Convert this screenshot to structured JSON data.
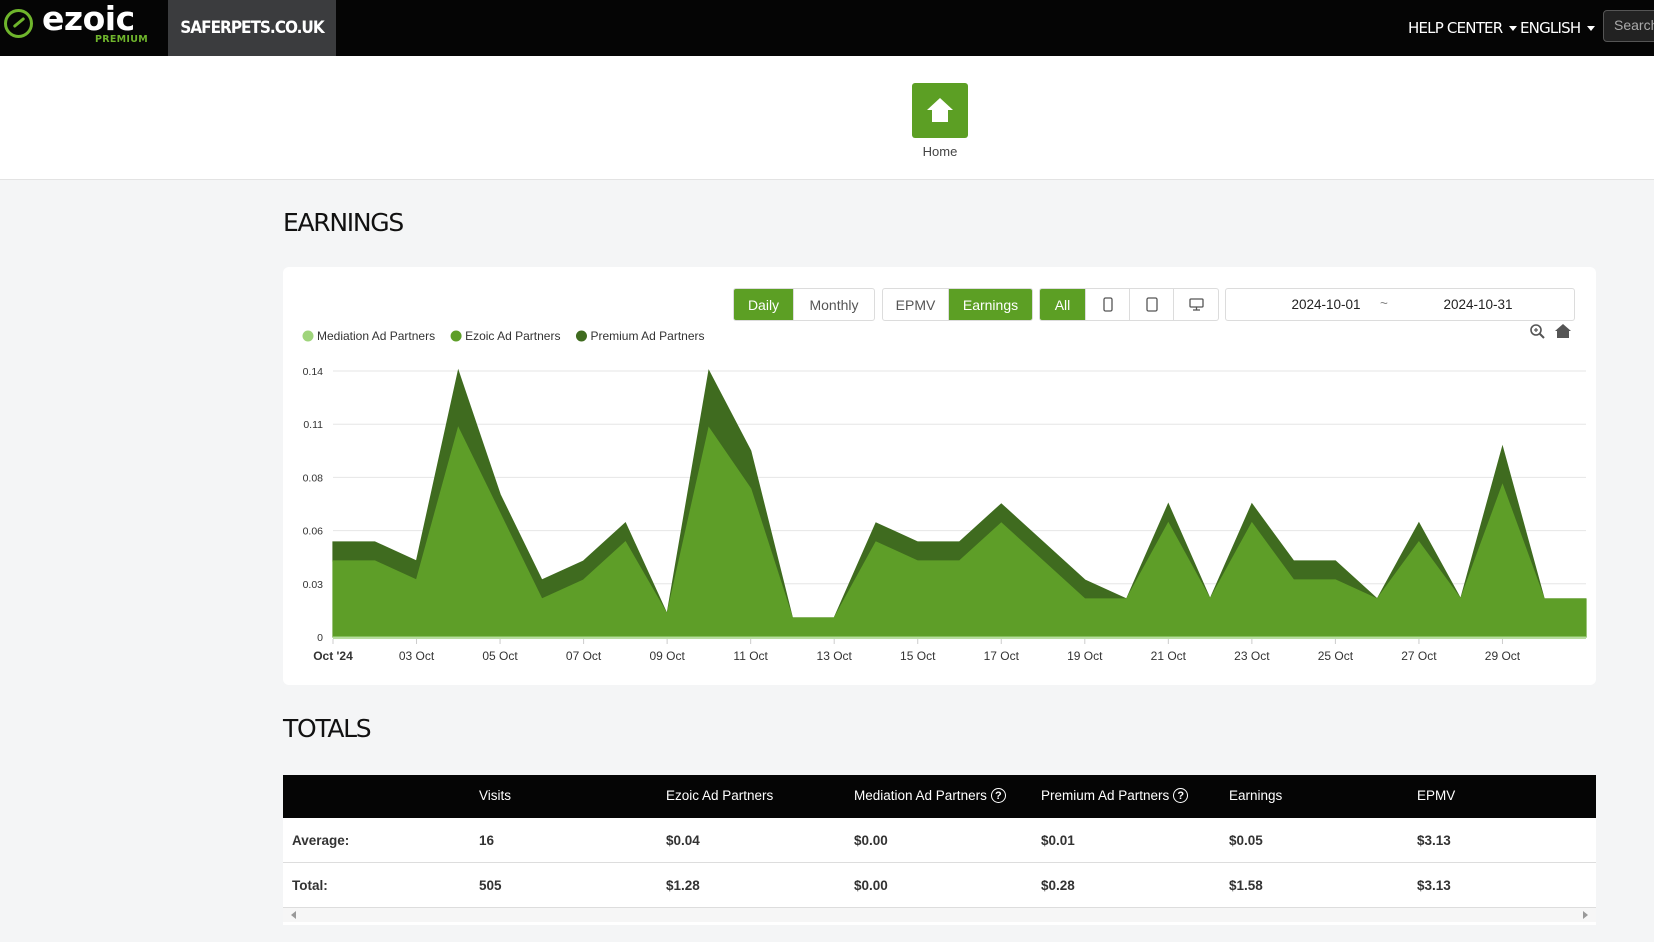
{
  "topbar": {
    "logo_text": "ezoic",
    "logo_sub": "PREMIUM",
    "site_name": "SAFERPETS.CO.UK",
    "help_center": "HELP CENTER",
    "language": "ENGLISH",
    "search_placeholder": "Search"
  },
  "home": {
    "label": "Home"
  },
  "earnings": {
    "title": "EARNINGS",
    "period_buttons": [
      "Daily",
      "Monthly"
    ],
    "metric_buttons": [
      "EPMV",
      "Earnings"
    ],
    "device_all": "All",
    "date_from": "2024-10-01",
    "date_sep": "~",
    "date_to": "2024-10-31"
  },
  "chart_data": {
    "type": "area",
    "stacked": true,
    "title": "",
    "xlabel": "",
    "ylabel": "",
    "ylim": [
      0,
      0.14
    ],
    "yticks": [
      "0",
      "0.03",
      "0.06",
      "0.08",
      "0.11",
      "0.14"
    ],
    "ytick_values": [
      0,
      0.028,
      0.056,
      0.084,
      0.112,
      0.14
    ],
    "xtick_labels": [
      "Oct '24",
      "03 Oct",
      "05 Oct",
      "07 Oct",
      "09 Oct",
      "11 Oct",
      "13 Oct",
      "15 Oct",
      "17 Oct",
      "19 Oct",
      "21 Oct",
      "23 Oct",
      "25 Oct",
      "27 Oct",
      "29 Oct"
    ],
    "x": [
      "2024-10-01",
      "2024-10-02",
      "2024-10-03",
      "2024-10-04",
      "2024-10-05",
      "2024-10-06",
      "2024-10-07",
      "2024-10-08",
      "2024-10-09",
      "2024-10-10",
      "2024-10-11",
      "2024-10-12",
      "2024-10-13",
      "2024-10-14",
      "2024-10-15",
      "2024-10-16",
      "2024-10-17",
      "2024-10-18",
      "2024-10-19",
      "2024-10-20",
      "2024-10-21",
      "2024-10-22",
      "2024-10-23",
      "2024-10-24",
      "2024-10-25",
      "2024-10-26",
      "2024-10-27",
      "2024-10-28",
      "2024-10-29",
      "2024-10-30",
      "2024-10-31"
    ],
    "legend_position": "top-left",
    "grid": true,
    "series": [
      {
        "name": "Mediation Ad Partners",
        "color": "#9fd47b",
        "values": [
          0,
          0,
          0,
          0,
          0,
          0,
          0,
          0,
          0,
          0,
          0,
          0,
          0,
          0,
          0,
          0,
          0,
          0,
          0,
          0,
          0,
          0,
          0,
          0,
          0,
          0,
          0,
          0,
          0,
          0,
          0
        ]
      },
      {
        "name": "Ezoic Ad Partners",
        "color": "#5e9e28",
        "values": [
          0.04,
          0.04,
          0.03,
          0.11,
          0.065,
          0.02,
          0.03,
          0.05,
          0.012,
          0.11,
          0.078,
          0.01,
          0.01,
          0.05,
          0.04,
          0.04,
          0.06,
          0.04,
          0.02,
          0.02,
          0.06,
          0.02,
          0.06,
          0.03,
          0.03,
          0.02,
          0.05,
          0.02,
          0.08,
          0.02,
          0.02
        ]
      },
      {
        "name": "Premium Ad Partners",
        "color": "#3f6b1f",
        "values": [
          0.01,
          0.01,
          0.01,
          0.03,
          0.01,
          0.01,
          0.01,
          0.01,
          0,
          0.03,
          0.02,
          0,
          0,
          0.01,
          0.01,
          0.01,
          0.01,
          0.01,
          0.01,
          0,
          0.01,
          0,
          0.01,
          0.01,
          0.01,
          0,
          0.01,
          0,
          0.02,
          0,
          0
        ]
      }
    ]
  },
  "totals": {
    "title": "TOTALS",
    "headers": [
      "",
      "Visits",
      "Ezoic Ad Partners",
      "Mediation Ad Partners",
      "Premium Ad Partners",
      "Earnings",
      "EPMV"
    ],
    "rows": [
      {
        "label": "Average:",
        "visits": "16",
        "ezoic": "$0.04",
        "mediation": "$0.00",
        "premium": "$0.01",
        "earnings": "$0.05",
        "epmv": "$3.13"
      },
      {
        "label": "Total:",
        "visits": "505",
        "ezoic": "$1.28",
        "mediation": "$0.00",
        "premium": "$0.28",
        "earnings": "$1.58",
        "epmv": "$3.13"
      }
    ]
  }
}
